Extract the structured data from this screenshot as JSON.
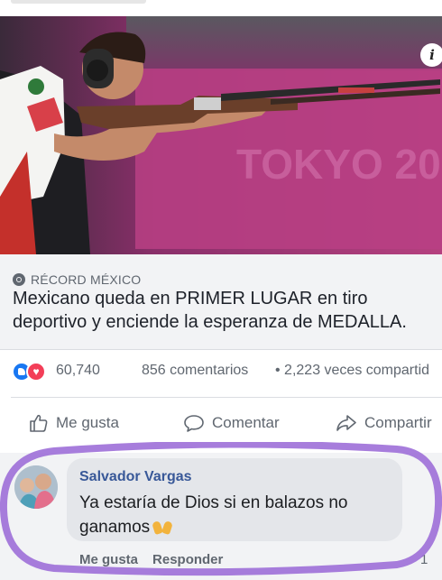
{
  "post": {
    "source": "RÉCORD MÉXICO",
    "headline_line1": "Mexicano queda en PRIMER LUGAR en tiro",
    "headline_line2": "deportivo y enciende la esperanza de MEDALLA.",
    "info_glyph": "i",
    "photo_banner_text": "TOKYO 20"
  },
  "stats": {
    "reaction_count": "60,740",
    "comments": "856 comentarios",
    "shares": "• 2,223 veces compartid",
    "reaction_icons": [
      "like-reaction-icon",
      "love-reaction-icon"
    ]
  },
  "actions": {
    "like": "Me gusta",
    "comment": "Comentar",
    "share": "Compartir"
  },
  "comment": {
    "author": "Salvador Vargas",
    "text": "Ya estaría de Dios si en balazos no ganamos",
    "like_link": "Me gusta",
    "reply_link": "Responder",
    "reaction_count": "1"
  },
  "colors": {
    "link_blue": "#385898",
    "like_blue": "#1877f2",
    "love_red": "#f33e58",
    "highlight_purple": "#9d6fd8",
    "photo_magenta": "#b0337e"
  }
}
